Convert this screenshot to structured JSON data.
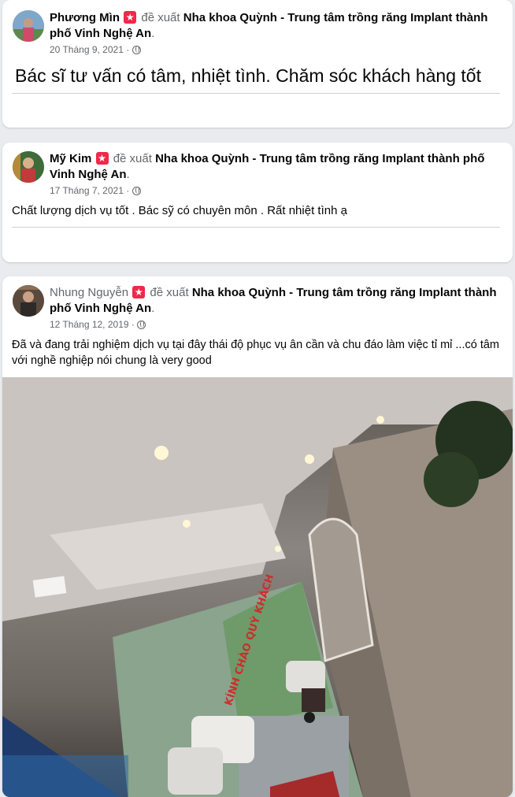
{
  "posts": [
    {
      "author": "Phương Mìn",
      "verb": "đề xuất",
      "page": "Nha khoa Quỳnh - Trung tâm trồng răng Implant thành phố Vinh Nghệ An",
      "date": "20 Tháng 9, 2021",
      "text": "Bác sĩ tư vấn có tâm, nhiệt tình. Chăm sóc khách hàng tốt"
    },
    {
      "author": "Mỹ Kim",
      "verb": "đề xuất",
      "page": "Nha khoa Quỳnh - Trung tâm trồng răng Implant thành phố Vinh Nghệ An",
      "date": "17 Tháng 7, 2021",
      "text": "Chất lượng dịch vụ tốt . Bác sỹ có chuyên môn . Rất nhiệt tình ạ"
    },
    {
      "author": "Nhung Nguyễn",
      "verb": "đề xuất",
      "page": "Nha khoa Quỳnh - Trung tâm trồng răng Implant thành phố Vinh Nghệ An",
      "date": "12 Tháng 12, 2019",
      "text": "Đã và đang trải nghiệm dịch vụ tại đây thái độ phục vụ ân cần và chu đáo làm việc tỉ mỉ ...có tâm với nghề nghiệp nói chung là very good",
      "photo_sign": "KÍNH CHÀO QUÝ KHÁCH"
    }
  ]
}
